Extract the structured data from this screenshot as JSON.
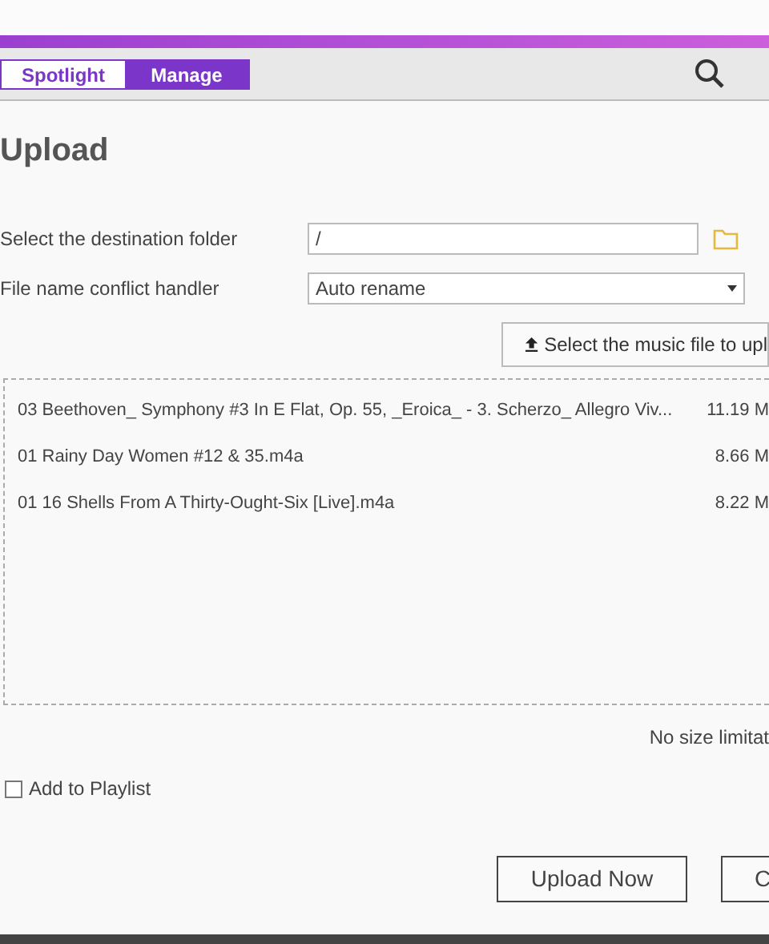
{
  "tabs": [
    {
      "label": "Spotlight",
      "selected": false
    },
    {
      "label": "Manage",
      "selected": true
    }
  ],
  "title": "Upload",
  "destination_folder": {
    "label": "Select the destination folder",
    "value": "/"
  },
  "conflict_handler": {
    "label": "File name conflict handler",
    "value": "Auto rename"
  },
  "select_button": "Select the music file to upl",
  "files": [
    {
      "name": "03 Beethoven_ Symphony #3 In E Flat, Op. 55, _Eroica_ - 3. Scherzo_ Allegro Viv...",
      "size": "11.19 M"
    },
    {
      "name": "01 Rainy Day Women #12 & 35.m4a",
      "size": "8.66 M"
    },
    {
      "name": "01 16 Shells From A Thirty-Ought-Six [Live].m4a",
      "size": "8.22 M"
    }
  ],
  "size_note": "No size limitat",
  "add_to_playlist": {
    "label": "Add to Playlist",
    "checked": false
  },
  "buttons": [
    "Upload Now",
    "C"
  ]
}
